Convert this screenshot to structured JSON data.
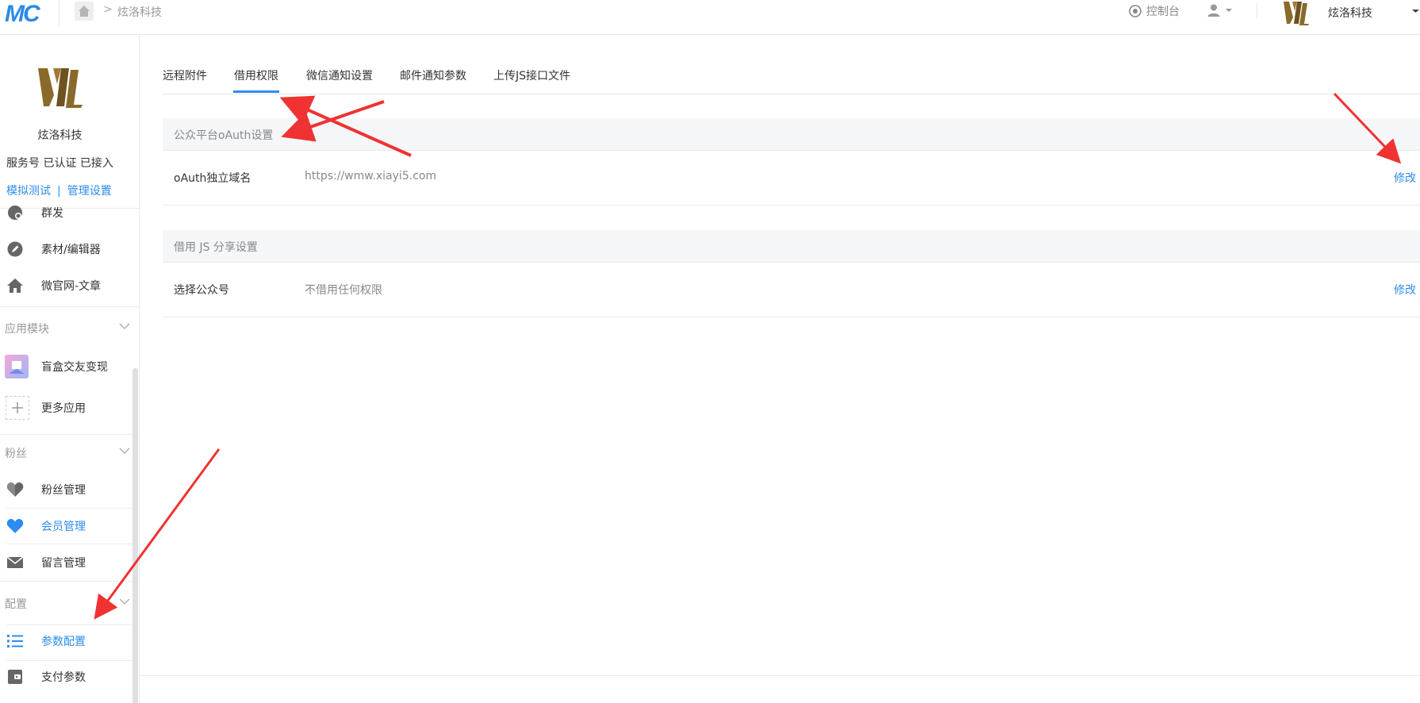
{
  "header": {
    "logo_text": "MC",
    "breadcrumb_sep": ">",
    "breadcrumb_text": "炫洛科技",
    "console_label": "控制台",
    "brand_name": "炫洛科技"
  },
  "sidebar": {
    "account_name": "炫洛科技",
    "account_status": "服务号 已认证 已接入",
    "link_test": "模拟测试",
    "link_sep": "|",
    "link_manage": "管理设置",
    "items_top": [
      {
        "label": "群发",
        "icon": "broadcast-icon"
      },
      {
        "label": "素材/编辑器",
        "icon": "pencil-icon"
      },
      {
        "label": "微官网-文章",
        "icon": "home-icon"
      }
    ],
    "groups": {
      "apps": "应用模块",
      "fans": "粉丝",
      "config": "配置"
    },
    "items_apps": [
      {
        "label": "盲盒交友变现",
        "icon": "app-thumbnail-icon"
      },
      {
        "label": "更多应用",
        "icon": "plus-icon"
      }
    ],
    "items_fans": [
      {
        "label": "粉丝管理",
        "icon": "heart-icon"
      },
      {
        "label": "会员管理",
        "icon": "heart-filled-icon",
        "active": true
      },
      {
        "label": "留言管理",
        "icon": "mail-icon"
      }
    ],
    "items_config": [
      {
        "label": "参数配置",
        "icon": "list-icon",
        "active": true
      },
      {
        "label": "支付参数",
        "icon": "wallet-icon"
      }
    ]
  },
  "tabs": [
    {
      "label": "远程附件"
    },
    {
      "label": "借用权限",
      "active": true
    },
    {
      "label": "微信通知设置"
    },
    {
      "label": "邮件通知参数"
    },
    {
      "label": "上传JS接口文件"
    }
  ],
  "sections": [
    {
      "title": "公众平台oAuth设置",
      "rows": [
        {
          "key": "oAuth独立域名",
          "value": "https://wmw.xiayi5.com",
          "action": "修改"
        }
      ]
    },
    {
      "title": "借用 JS 分享设置",
      "rows": [
        {
          "key": "选择公众号",
          "value": "不借用任何权限",
          "action": "修改"
        }
      ]
    }
  ],
  "colors": {
    "accent": "#2d8cf0",
    "logo": "#2a8be6",
    "annotation": "#f03232",
    "brand_gold": "#8a6a2a"
  }
}
